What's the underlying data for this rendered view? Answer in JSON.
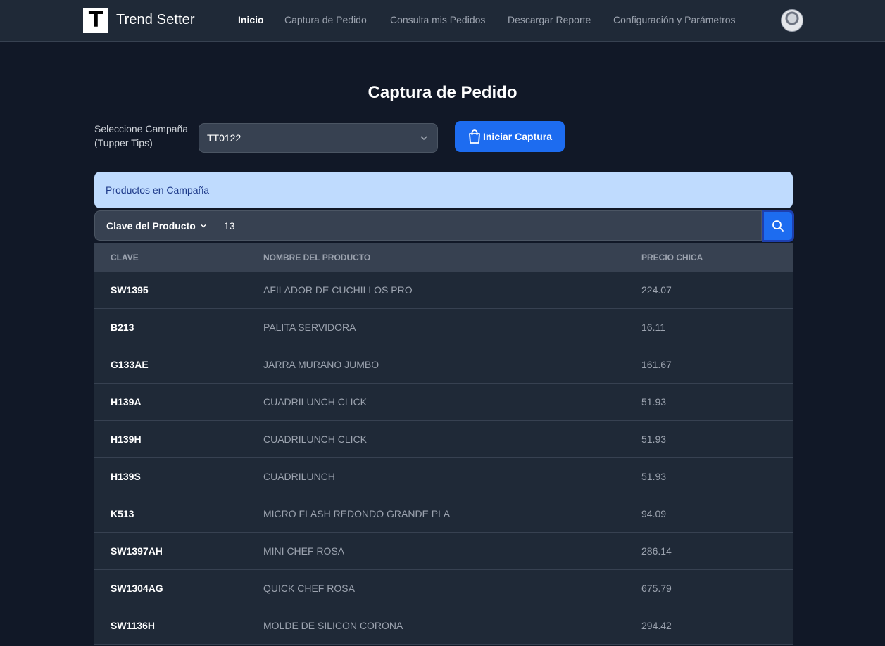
{
  "nav": {
    "logo_letter": "T",
    "brand": "Trend Setter",
    "links": [
      "Inicio",
      "Captura de Pedido",
      "Consulta mis Pedidos",
      "Descargar Reporte",
      "Configuración y Parámetros"
    ],
    "active_link": "Inicio"
  },
  "page": {
    "title": "Captura de Pedido",
    "campaign_label_line1": "Seleccione Campaña",
    "campaign_label_line2": "(Tupper Tips)",
    "campaign_selected": "TT0122",
    "start_button": "Iniciar Captura",
    "alert_text": "Productos en Campaña"
  },
  "search": {
    "filter_label": "Clave del Producto",
    "value": "13"
  },
  "table": {
    "headers": [
      "CLAVE",
      "NOMBRE DEL PRODUCTO",
      "PRECIO CHICA"
    ],
    "rows": [
      [
        "SW1395",
        "AFILADOR DE CUCHILLOS PRO",
        "224.07"
      ],
      [
        "B213",
        "PALITA SERVIDORA",
        "16.11"
      ],
      [
        "G133AE",
        "JARRA MURANO JUMBO",
        "161.67"
      ],
      [
        "H139A",
        "CUADRILUNCH CLICK",
        "51.93"
      ],
      [
        "H139H",
        "CUADRILUNCH CLICK",
        "51.93"
      ],
      [
        "H139S",
        "CUADRILUNCH",
        "51.93"
      ],
      [
        "K513",
        "MICRO FLASH REDONDO GRANDE PLA",
        "94.09"
      ],
      [
        "SW1397AH",
        "MINI CHEF ROSA",
        "286.14"
      ],
      [
        "SW1304AG",
        "QUICK CHEF ROSA",
        "675.79"
      ],
      [
        "SW1136H",
        "MOLDE DE SILICON CORONA",
        "294.42"
      ]
    ]
  },
  "colors": {
    "background": "#111827",
    "navbar": "#1f2937",
    "primary": "#1d6cf0",
    "alert_bg": "#bfdbfe",
    "alert_text": "#1e3a8a"
  },
  "icons": {
    "start_button_icon": "shopping-bag-icon",
    "search_button_icon": "search-icon",
    "select_icon": "chevron-down-icon",
    "filter_icon": "chevron-down-icon"
  }
}
